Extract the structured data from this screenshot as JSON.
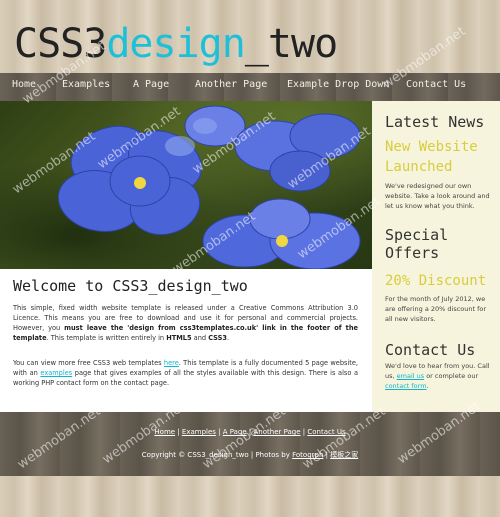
{
  "logo": {
    "part1": "CSS3",
    "part2": "design",
    "part3": "_two"
  },
  "nav": {
    "items": [
      {
        "label": "Home"
      },
      {
        "label": "Examples"
      },
      {
        "label": "A Page"
      },
      {
        "label": "Another Page"
      },
      {
        "label": "Example Drop Down"
      },
      {
        "label": "Contact Us"
      }
    ]
  },
  "main": {
    "title": "Welcome to CSS3_design_two",
    "p1_a": "This simple, fixed width website template is released under a Creative Commons Attribution 3.0 Licence. This means you are free to download and use it for personal and commercial projects. However, you ",
    "p1_bold": "must leave the 'design from css3templates.co.uk' link in the footer of the template",
    "p1_b": ". This template is written entirely in ",
    "p1_html5": "HTML5",
    "p1_and": " and ",
    "p1_css3": "CSS3",
    "p1_end": ".",
    "p2_a": "You can view more free CSS3 web templates ",
    "p2_link1": "here",
    "p2_b": ". This template is a fully documented 5 page website, with an ",
    "p2_link2": "examples",
    "p2_c": " page that gives examples of all the styles available with this design. There is also a working PHP contact form on the contact page."
  },
  "sidebar": {
    "news_heading": "Latest News",
    "news_title": "New Website Launched",
    "news_text": "We've redesigned our own website. Take a look around and let us know what you think.",
    "offers_heading": "Special Offers",
    "offers_title": "20% Discount",
    "offers_text": "For the month of July 2012, we are offering a 20% discount for all new visitors.",
    "contact_heading": "Contact Us",
    "contact_a": "We'd love to hear from you. Call us, ",
    "contact_email": "email us",
    "contact_b": " or complete our ",
    "contact_form": "contact form",
    "contact_end": "."
  },
  "footer": {
    "links": [
      "Home",
      "Examples",
      "A Page",
      "Another Page",
      "Contact Us"
    ],
    "separator": " | ",
    "copyright_a": "Copyright © CSS3_design_two | Photos by ",
    "photos_link": "Fotogrph",
    "copyright_sep": " | ",
    "cn_link": "模板之家"
  },
  "watermark": "webmoban.net",
  "colors": {
    "accent": "#1ec0d8",
    "sidebar_accent": "#d8cd3c",
    "sidebar_bg": "#f6f4dd",
    "nav_bg": "#645c51"
  }
}
